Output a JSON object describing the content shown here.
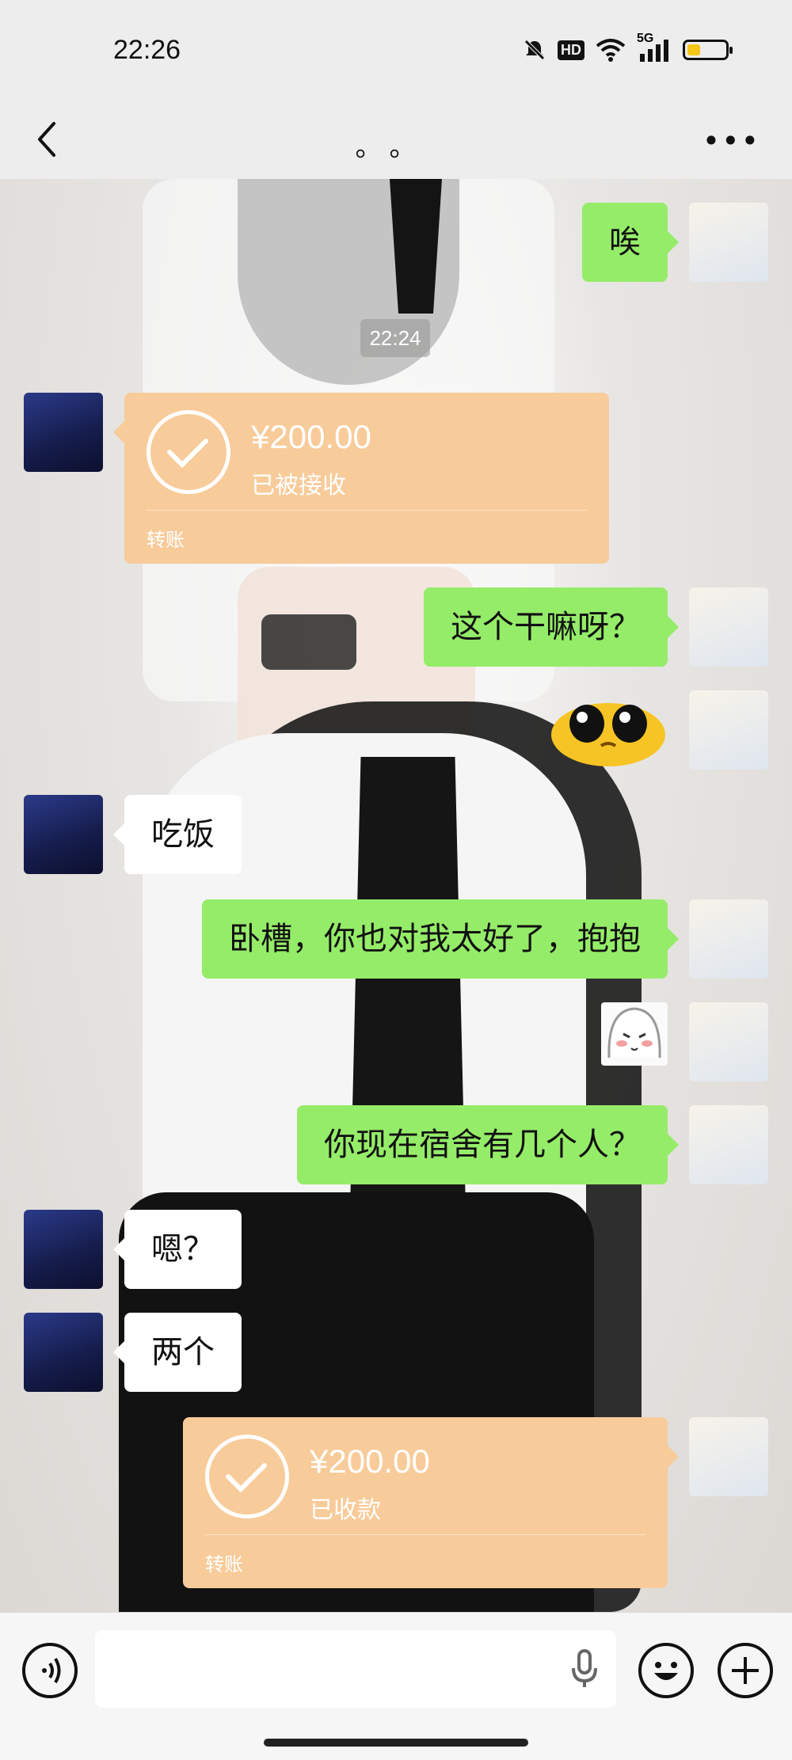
{
  "status_bar": {
    "time": "22:26",
    "network": "5G",
    "hd": "HD",
    "battery_level": 0.35,
    "battery_color": "#f5c518"
  },
  "header": {
    "title": "。。",
    "back_icon": "chevron-left-icon",
    "more_icon": "more-horizontal-icon"
  },
  "chat_timestamp": "22:24",
  "messages": [
    {
      "side": "right",
      "type": "text",
      "text": "唉"
    },
    {
      "side": "left",
      "type": "transfer",
      "amount": "¥200.00",
      "status": "已被接收",
      "label": "转账"
    },
    {
      "side": "right",
      "type": "text",
      "text": "这个干嘛呀？"
    },
    {
      "side": "right",
      "type": "sticker",
      "sticker": "crying-yellow-blob-sticker"
    },
    {
      "side": "left",
      "type": "text",
      "text": "吃饭"
    },
    {
      "side": "right",
      "type": "text",
      "text": "卧槽，你也对我太好了，抱抱"
    },
    {
      "side": "right",
      "type": "sticker",
      "sticker": "blushing-anime-girl-sticker"
    },
    {
      "side": "right",
      "type": "text",
      "text": "你现在宿舍有几个人？"
    },
    {
      "side": "left",
      "type": "text",
      "text": "嗯？"
    },
    {
      "side": "left",
      "type": "text",
      "text": "两个"
    },
    {
      "side": "right",
      "type": "transfer",
      "amount": "¥200.00",
      "status": "已收款",
      "label": "转账"
    }
  ],
  "input_bar": {
    "voice_icon": "voice-mode-icon",
    "mic_icon": "microphone-icon",
    "emoji_icon": "emoji-icon",
    "plus_icon": "plus-icon"
  },
  "colors": {
    "bubble_self": "#95ec69",
    "bubble_other": "#ffffff",
    "transfer": "#f8cb9a"
  }
}
